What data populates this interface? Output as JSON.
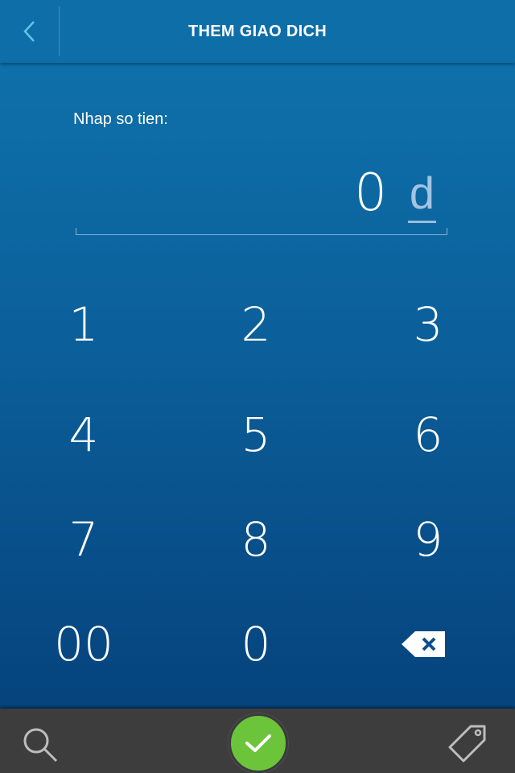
{
  "header": {
    "title": "THEM GIAO DICH",
    "back_icon": "chevron-left-icon"
  },
  "amount": {
    "label": "Nhap so tien:",
    "value": "0",
    "currency": "d"
  },
  "keypad": {
    "keys": [
      "1",
      "2",
      "3",
      "4",
      "5",
      "6",
      "7",
      "8",
      "9",
      "00",
      "0"
    ],
    "backspace_icon": "backspace-icon"
  },
  "footer": {
    "search_icon": "search-icon",
    "confirm_icon": "checkmark-icon",
    "tag_icon": "tag-icon"
  },
  "colors": {
    "header": "#0e6ea8",
    "background_top": "#0f74ad",
    "background_bottom": "#053e78",
    "confirm": "#6cc43b",
    "footer": "#3d3d3d"
  }
}
